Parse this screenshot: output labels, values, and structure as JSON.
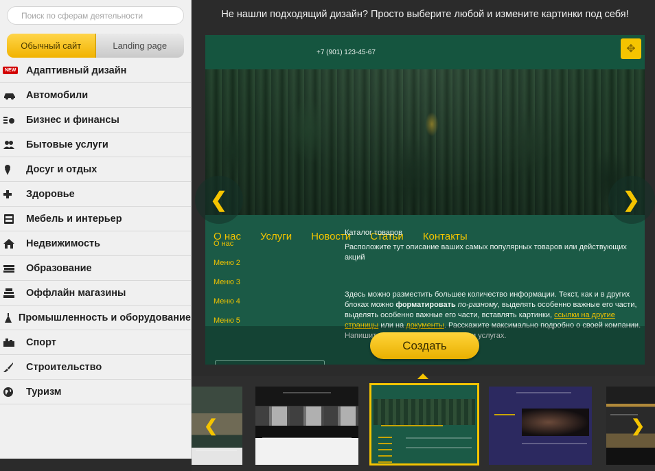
{
  "sidebar": {
    "search_placeholder": "Поиск по сферам деятельности",
    "switch": {
      "active": "Обычный сайт",
      "inactive": "Landing page"
    },
    "new_badge": "NEW",
    "categories": [
      {
        "label": "Адаптивный дизайн",
        "icon": "new-badge-icon"
      },
      {
        "label": "Автомобили",
        "icon": "car-icon"
      },
      {
        "label": "Бизнес и финансы",
        "icon": "finance-icon"
      },
      {
        "label": "Бытовые услуги",
        "icon": "people-icon"
      },
      {
        "label": "Досуг и отдых",
        "icon": "ice-cream-icon"
      },
      {
        "label": "Здоровье",
        "icon": "cross-icon"
      },
      {
        "label": "Мебель и интерьер",
        "icon": "furniture-icon"
      },
      {
        "label": "Недвижимость",
        "icon": "house-icon"
      },
      {
        "label": "Образование",
        "icon": "books-icon"
      },
      {
        "label": "Оффлайн магазины",
        "icon": "shop-icon"
      },
      {
        "label": "Промышленность и оборудование",
        "icon": "factory-icon"
      },
      {
        "label": "Спорт",
        "icon": "sport-icon"
      },
      {
        "label": "Строительство",
        "icon": "brush-icon"
      },
      {
        "label": "Туризм",
        "icon": "globe-icon"
      }
    ]
  },
  "main": {
    "headline": "Не нашли подходящий дизайн? Просто выберите любой и измените картинки под себя!",
    "preview": {
      "phone": "+7 (901) 123-45-67",
      "nav": [
        "О нас",
        "Услуги",
        "Новости",
        "Статьи",
        "Контакты"
      ],
      "aside": [
        "О нас",
        "Меню 2",
        "Меню 3",
        "Меню 4",
        "Меню 5"
      ],
      "catalog_title": "Каталог товаров",
      "catalog_desc": "Расположите тут описание ваших самых популярных товаров или действующих акций",
      "body_1": "Здесь можно разместить большее количество информации. Текст, как и в других блоках можно ",
      "body_bold": "форматировать",
      "body_space": " ",
      "body_italic": "по-разному",
      "body_2": ", выделять особенно важные его части, выделять особенно важные его части, вставлять картинки, ",
      "body_link1": "ссылки на другие страницы",
      "body_3": " или на ",
      "body_link2": "документы",
      "body_4": ". Расскажите максимально подробно о своей компании. Напишите о предлагаемых товарах и услугах."
    },
    "create_button": "Создать"
  },
  "colors": {
    "accent": "#f5c400",
    "preview_green": "#1b5a46",
    "dark_bg": "#2b2b2b"
  }
}
